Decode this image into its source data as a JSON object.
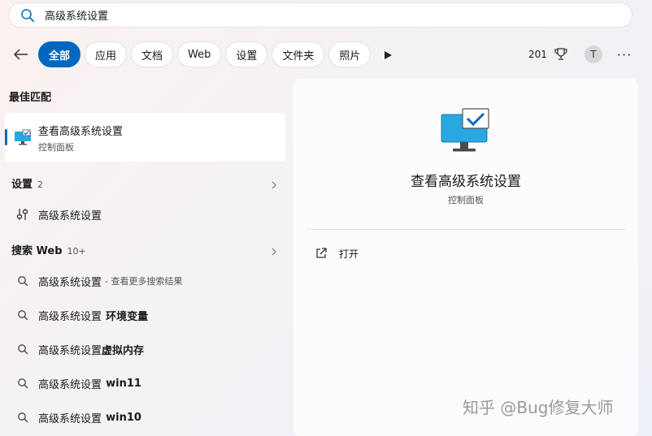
{
  "search": {
    "value": "高级系统设置"
  },
  "filters": {
    "tabs": [
      {
        "label": "全部"
      },
      {
        "label": "应用"
      },
      {
        "label": "文档"
      },
      {
        "label": "Web"
      },
      {
        "label": "设置"
      },
      {
        "label": "文件夹"
      },
      {
        "label": "照片"
      }
    ],
    "points": "201",
    "avatar_letter": "T",
    "more": "···"
  },
  "best_match": {
    "title": "最佳匹配",
    "name": "查看高级系统设置",
    "category": "控制面板"
  },
  "settings_section": {
    "title": "设置",
    "count": "2",
    "items": [
      {
        "label": "高级系统设置"
      }
    ]
  },
  "web_section": {
    "title": "搜索 Web",
    "count": "10+",
    "items": [
      {
        "label": "高级系统设置",
        "sub": "- 查看更多搜索结果"
      },
      {
        "label": "高级系统设置",
        "bold": "环境变量"
      },
      {
        "label": "高级系统设置",
        "bold": "虚拟内存"
      },
      {
        "label": "高级系统设置",
        "bold": "win11"
      },
      {
        "label": "高级系统设置",
        "bold": "win10"
      }
    ]
  },
  "detail": {
    "title": "查看高级系统设置",
    "subtitle": "控制面板",
    "action": "打开"
  },
  "watermark": "知乎 @Bug修复大师",
  "colors": {
    "accent": "#0067c0",
    "monitor": "#29a7e0"
  }
}
